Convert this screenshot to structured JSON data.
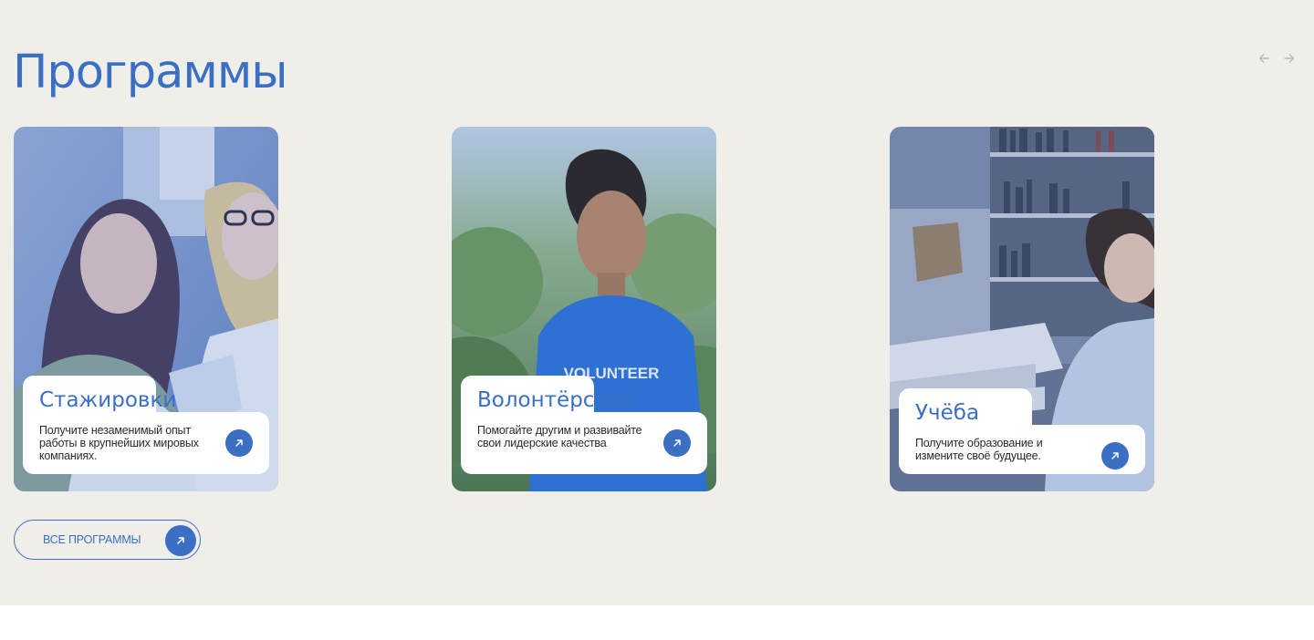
{
  "section": {
    "title": "Программы",
    "nav": {
      "prev_icon": "arrow-left-icon",
      "next_icon": "arrow-right-icon"
    }
  },
  "cards": [
    {
      "title": "Стажировки",
      "description": "Получите незаменимый опыт работы в крупнейших мировых компаниях.",
      "image_subject": "two young women looking at documents",
      "button_icon": "arrow-up-right-icon"
    },
    {
      "title": "Волонтёрство",
      "description": "Помогайте другим и развивайте свои лидерские качества",
      "image_subject": "young man in blue VOLUNTEER t-shirt",
      "image_text": "VOLUNTEER",
      "button_icon": "arrow-up-right-icon"
    },
    {
      "title": "Учёба",
      "description": "Получите образование и измените своё будущее.",
      "image_subject": "student writing in library",
      "button_icon": "arrow-up-right-icon"
    }
  ],
  "all_button": {
    "label": "ВСЕ ПРОГРАММЫ",
    "icon": "arrow-up-right-icon"
  },
  "colors": {
    "accent": "#3a6fc4",
    "background": "#f0eee9",
    "card_panel": "#ffffff"
  }
}
